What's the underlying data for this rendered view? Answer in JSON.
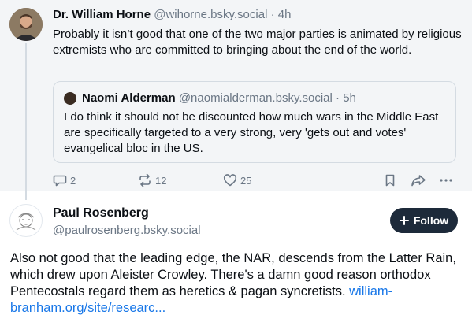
{
  "post1": {
    "author_name": "Dr. William Horne",
    "author_handle": "@wihorne.bsky.social",
    "separator": "·",
    "time": "4h",
    "text": "Probably it isn’t good that one of the two major parties is animated by religious extremists who are committed to bringing about the end of the world.",
    "quote": {
      "author_name": "Naomi Alderman",
      "author_handle": "@naomialderman.bsky.social",
      "separator": "·",
      "time": "5h",
      "text": "I do think it should not be discounted how much wars in the Middle East are specifically targeted to a very strong, very 'gets out and votes' evangelical bloc in the US."
    },
    "actions": {
      "reply_count": "2",
      "repost_count": "12",
      "like_count": "25",
      "icons": [
        "reply-icon",
        "repost-icon",
        "like-icon",
        "bookmark-icon",
        "share-icon",
        "more-icon"
      ]
    }
  },
  "post2": {
    "author_name": "Paul Rosenberg",
    "author_handle": "@paulrosenberg.bsky.social",
    "follow_label": "Follow",
    "text": "Also not good that the leading edge, the NAR, descends from the Latter Rain, which drew upon Aleister Crowley. There's a damn good reason orthodox Pentecostals regard them as heretics & pagan syncretists.",
    "link_text": "william-branham.org/site/researc..."
  },
  "colors": {
    "muted": "#6b7785",
    "link": "#1877e8",
    "follow_button": "#1d2a3a",
    "thread_background": "#f3f5f7"
  }
}
